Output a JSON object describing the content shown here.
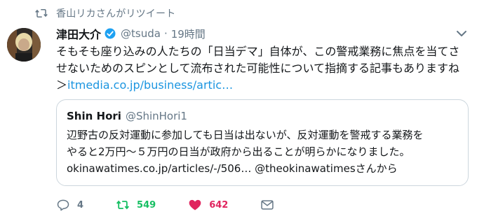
{
  "retweet_bar": {
    "text": "香山リカさんがリツイート"
  },
  "author": {
    "display_name": "津田大介",
    "handle": "@tsuda",
    "separator": "·",
    "time": "19時間"
  },
  "tweet": {
    "line1": "そもそも座り込みの人たちの「日当デマ」自体が、この警戒業務に焦点を当てさ",
    "line2": "せないためのスピンとして流布された可能性について指摘する記事もありますね",
    "link_prefix": "＞",
    "link": "itmedia.co.jp/business/artic…"
  },
  "quote": {
    "name": "Shin Hori",
    "handle": "@ShinHori1",
    "line1": "辺野古の反対運動に参加しても日当は出ないが、反対運動を警戒する業務を",
    "line2": "やると2万円～５万円の日当が政府から出ることが明らかになりました。",
    "line3": "okinawatimes.co.jp/articles/-/506… @theokinawatimesさんから"
  },
  "actions": {
    "reply_count": "4",
    "retweet_count": "549",
    "like_count": "642"
  },
  "colors": {
    "text": "#14171a",
    "muted": "#657786",
    "link": "#1b95e0",
    "retweet_active": "#17bf63",
    "like_active": "#e0245e",
    "border": "#ccd6dd"
  }
}
